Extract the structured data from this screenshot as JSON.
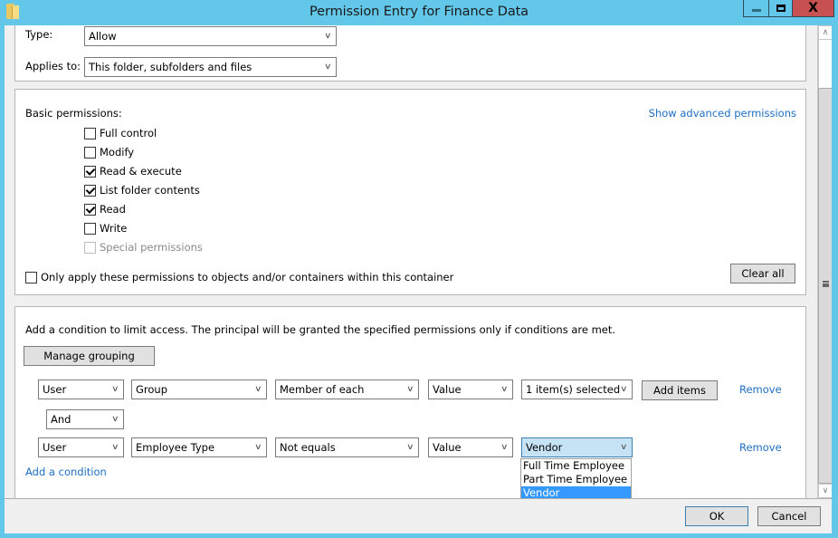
{
  "window": {
    "title": "Permission Entry for Finance Data",
    "icon": "folder-icon",
    "controls": {
      "minimize": "minimize-icon",
      "maximize": "maximize-icon",
      "close": "close-icon"
    }
  },
  "principal_section": {
    "type_label": "Type:",
    "type_value": "Allow",
    "applies_label": "Applies to:",
    "applies_value": "This folder, subfolders and files"
  },
  "permissions": {
    "heading": "Basic permissions:",
    "advanced_link": "Show advanced permissions",
    "items": [
      {
        "label": "Full control",
        "checked": false,
        "enabled": true
      },
      {
        "label": "Modify",
        "checked": false,
        "enabled": true
      },
      {
        "label": "Read & execute",
        "checked": true,
        "enabled": true
      },
      {
        "label": "List folder contents",
        "checked": true,
        "enabled": true
      },
      {
        "label": "Read",
        "checked": true,
        "enabled": true
      },
      {
        "label": "Write",
        "checked": false,
        "enabled": true
      },
      {
        "label": "Special permissions",
        "checked": false,
        "enabled": false
      }
    ],
    "only_apply_label": "Only apply these permissions to objects and/or containers within this container",
    "only_apply_checked": false,
    "clear_all": "Clear all"
  },
  "conditions": {
    "description": "Add a condition to limit access. The principal will be granted the specified permissions only if conditions are met.",
    "manage_grouping": "Manage grouping",
    "rows": [
      {
        "scope": "User",
        "attribute": "Group",
        "operator": "Member of each",
        "value_type": "Value",
        "value": "1 item(s) selected",
        "add_items": "Add items",
        "remove": "Remove"
      },
      {
        "scope": "User",
        "attribute": "Employee Type",
        "operator": "Not equals",
        "value_type": "Value",
        "value": "Vendor",
        "remove": "Remove"
      }
    ],
    "connector": "And",
    "add_condition": "Add a condition",
    "value_dropdown_options": [
      "Full Time Employee",
      "Part Time Employee",
      "Vendor"
    ],
    "value_dropdown_selected": "Vendor"
  },
  "footer": {
    "ok": "OK",
    "cancel": "Cancel"
  }
}
